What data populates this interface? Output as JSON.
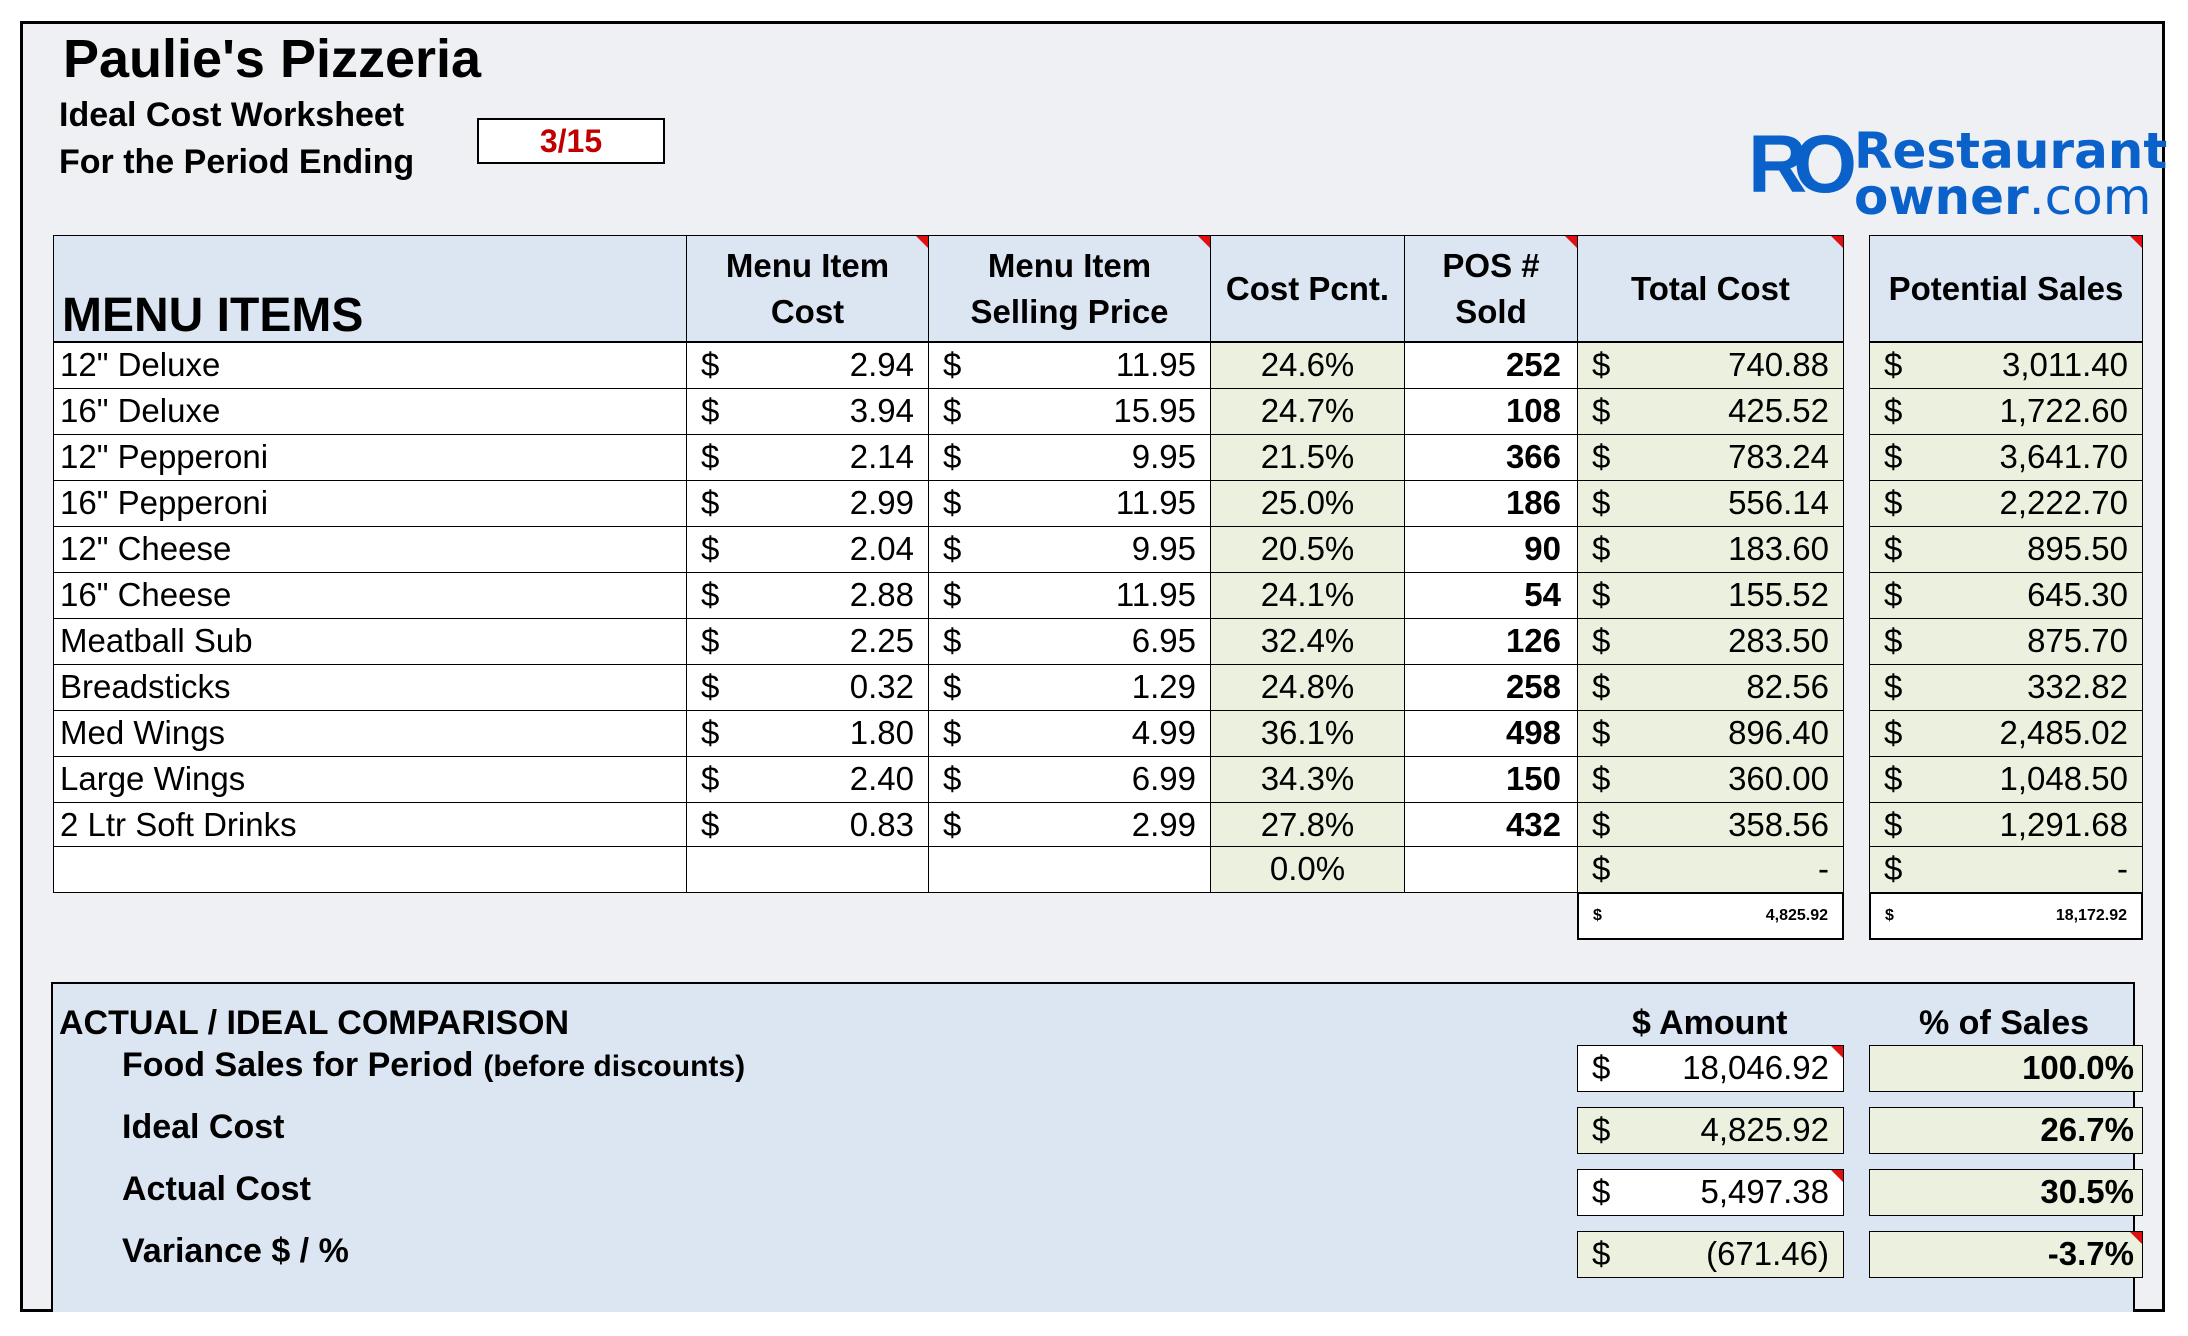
{
  "header": {
    "title": "Paulie's Pizzeria",
    "subtitle": "Ideal Cost Worksheet",
    "period_label": "For the Period Ending",
    "period_value": "3/15"
  },
  "logo": {
    "mark": "RO",
    "line1": "Restaurant",
    "line2_main": "owner",
    "line2_suffix": ".com"
  },
  "table": {
    "headers": {
      "items": "MENU ITEMS",
      "cost_l1": "Menu Item",
      "cost_l2": "Cost",
      "price_l1": "Menu Item",
      "price_l2": "Selling Price",
      "pct": "Cost Pcnt.",
      "sold_l1": "POS #",
      "sold_l2": "Sold",
      "total": "Total Cost",
      "sales": "Potential Sales"
    },
    "currency": "$",
    "rows": [
      {
        "name": "12\" Deluxe",
        "cost": "2.94",
        "price": "11.95",
        "pct": "24.6%",
        "sold": "252",
        "total": "740.88",
        "sales": "3,011.40"
      },
      {
        "name": "16\" Deluxe",
        "cost": "3.94",
        "price": "15.95",
        "pct": "24.7%",
        "sold": "108",
        "total": "425.52",
        "sales": "1,722.60"
      },
      {
        "name": "12\" Pepperoni",
        "cost": "2.14",
        "price": "9.95",
        "pct": "21.5%",
        "sold": "366",
        "total": "783.24",
        "sales": "3,641.70"
      },
      {
        "name": "16\" Pepperoni",
        "cost": "2.99",
        "price": "11.95",
        "pct": "25.0%",
        "sold": "186",
        "total": "556.14",
        "sales": "2,222.70"
      },
      {
        "name": "12\" Cheese",
        "cost": "2.04",
        "price": "9.95",
        "pct": "20.5%",
        "sold": "90",
        "total": "183.60",
        "sales": "895.50"
      },
      {
        "name": "16\" Cheese",
        "cost": "2.88",
        "price": "11.95",
        "pct": "24.1%",
        "sold": "54",
        "total": "155.52",
        "sales": "645.30"
      },
      {
        "name": "Meatball Sub",
        "cost": "2.25",
        "price": "6.95",
        "pct": "32.4%",
        "sold": "126",
        "total": "283.50",
        "sales": "875.70"
      },
      {
        "name": "Breadsticks",
        "cost": "0.32",
        "price": "1.29",
        "pct": "24.8%",
        "sold": "258",
        "total": "82.56",
        "sales": "332.82"
      },
      {
        "name": "Med Wings",
        "cost": "1.80",
        "price": "4.99",
        "pct": "36.1%",
        "sold": "498",
        "total": "896.40",
        "sales": "2,485.02"
      },
      {
        "name": "Large Wings",
        "cost": "2.40",
        "price": "6.99",
        "pct": "34.3%",
        "sold": "150",
        "total": "360.00",
        "sales": "1,048.50"
      },
      {
        "name": "2 Ltr Soft Drinks",
        "cost": "0.83",
        "price": "2.99",
        "pct": "27.8%",
        "sold": "432",
        "total": "358.56",
        "sales": "1,291.68"
      },
      {
        "name": "",
        "cost": "",
        "price": "",
        "pct": "0.0%",
        "sold": "",
        "total": "-",
        "sales": "-"
      }
    ],
    "totals": {
      "total": "4,825.92",
      "sales": "18,172.92"
    }
  },
  "comparison": {
    "title": "ACTUAL / IDEAL COMPARISON",
    "col_amount": "$ Amount",
    "col_pct": "% of Sales",
    "rows": [
      {
        "label": "Food Sales for Period",
        "note": "(before discounts)",
        "amount": "18,046.92",
        "pct": "100.0%"
      },
      {
        "label": "Ideal Cost",
        "note": "",
        "amount": "4,825.92",
        "pct": "26.7%"
      },
      {
        "label": "Actual Cost",
        "note": "",
        "amount": "5,497.38",
        "pct": "30.5%"
      },
      {
        "label": "Variance $ / %",
        "note": "",
        "amount": "(671.46)",
        "pct": "-3.7%"
      }
    ]
  },
  "colors": {
    "header_blue": "#dce6f2",
    "cell_green": "#ebf1de",
    "period_red": "#c00000",
    "logo_blue": "#0a61c9",
    "comment_marker": "#e01010"
  }
}
